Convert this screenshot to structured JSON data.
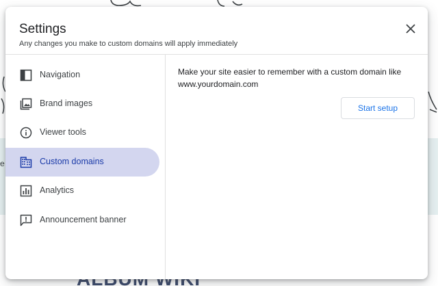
{
  "background": {
    "band_left_text": "e",
    "title_fragment": "ALBUM WIKI",
    "band_color": "#e6f0f1"
  },
  "dialog": {
    "title": "Settings",
    "subtitle": "Any changes you make to custom domains will apply immediately",
    "close_icon": "close-icon"
  },
  "sidebar": {
    "items": [
      {
        "label": "Navigation",
        "icon": "navigation-icon",
        "active": false
      },
      {
        "label": "Brand images",
        "icon": "brand-images-icon",
        "active": false
      },
      {
        "label": "Viewer tools",
        "icon": "info-icon",
        "active": false
      },
      {
        "label": "Custom domains",
        "icon": "domain-icon",
        "active": true
      },
      {
        "label": "Analytics",
        "icon": "analytics-icon",
        "active": false
      },
      {
        "label": "Announcement banner",
        "icon": "announcement-icon",
        "active": false
      }
    ]
  },
  "content": {
    "description": "Make your site easier to remember with a custom domain like www.yourdomain.com",
    "setup_button": "Start setup"
  },
  "colors": {
    "active_bg": "#d3d6ef",
    "active_text": "#1a3aa8",
    "link_blue": "#1a73e8"
  }
}
